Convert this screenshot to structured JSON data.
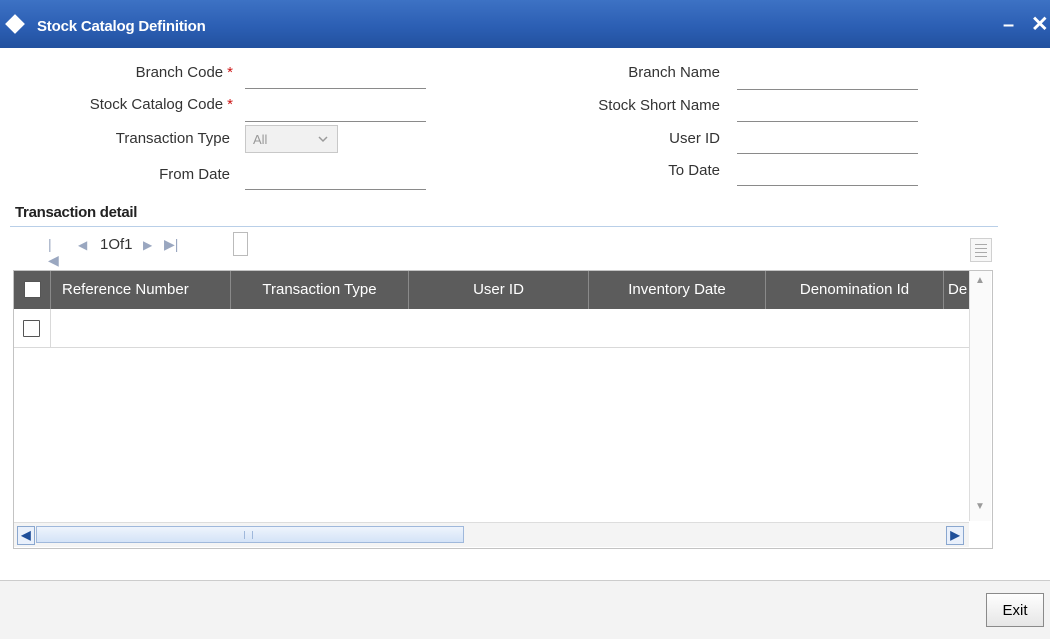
{
  "window": {
    "title": "Stock Catalog Definition",
    "minimize_glyph": "–",
    "close_glyph": "✕"
  },
  "form": {
    "branch_code": {
      "label": "Branch Code",
      "required_mark": "*",
      "value": ""
    },
    "stock_catalog_code": {
      "label": "Stock Catalog Code",
      "required_mark": "*",
      "value": ""
    },
    "transaction_type": {
      "label": "Transaction Type",
      "value": "All"
    },
    "from_date": {
      "label": "From Date",
      "value": ""
    },
    "branch_name": {
      "label": "Branch Name",
      "value": ""
    },
    "stock_short_name": {
      "label": "Stock Short Name",
      "value": ""
    },
    "user_id": {
      "label": "User ID",
      "value": ""
    },
    "to_date": {
      "label": "To Date",
      "value": ""
    }
  },
  "transaction_detail": {
    "section_title": "Transaction detail",
    "pager": {
      "text": "1Of1"
    },
    "columns": [
      "Reference Number",
      "Transaction Type",
      "User ID",
      "Inventory Date",
      "Denomination Id",
      "De"
    ],
    "rows": [
      {
        "checked": false
      }
    ]
  },
  "footer": {
    "exit_label": "Exit"
  },
  "icons": {
    "title": "diamond-icon",
    "pager": [
      "first-page-icon",
      "prev-page-icon",
      "next-page-icon",
      "last-page-icon"
    ],
    "grid_menu": "grid-menu-icon"
  },
  "colors": {
    "titlebar": "#2c5fb4",
    "table_header": "#5c5c5c",
    "required": "#cc1111",
    "scroll_accent": "#1f4f9a"
  }
}
